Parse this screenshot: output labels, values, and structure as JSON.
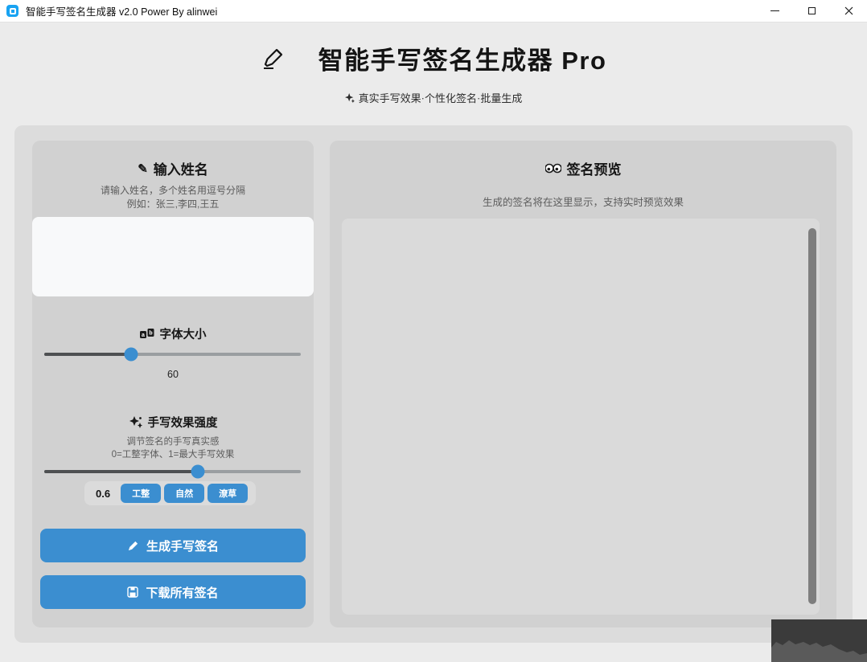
{
  "titlebar": {
    "app_title": "智能手写签名生成器 v2.0 Power By alinwei"
  },
  "header": {
    "title": "智能手写签名生成器 Pro",
    "subtitle": "真实手写效果·个性化签名·批量生成"
  },
  "name_section": {
    "heading": "输入姓名",
    "memo_glyph": "✎",
    "hint_line1": "请输入姓名，多个姓名用逗号分隔",
    "hint_line2": "例如：张三,李四,王五",
    "input_value": ""
  },
  "font_size_section": {
    "heading": "字体大小",
    "value": "60",
    "slider_percent": 34
  },
  "effect_section": {
    "heading": "手写效果强度",
    "hint_line1": "调节签名的手写真实感",
    "hint_line2": "0=工整字体、1=最大手写效果",
    "value": "0.6",
    "slider_percent": 60,
    "presets": [
      "工整",
      "自然",
      "潦草"
    ]
  },
  "actions": {
    "generate_label": "生成手写签名",
    "download_label": "下载所有签名"
  },
  "preview_section": {
    "heading": "签名预览",
    "hint": "生成的签名将在这里显示，支持实时预览效果"
  },
  "icons": {
    "app": "app-logo-square",
    "header": "writing-hand",
    "subtitle": "sparkle",
    "name": "memo-pencil",
    "font_size": "letter-tiles",
    "effect": "sparkles",
    "generate": "pen",
    "download": "save-disk",
    "preview": "eyes"
  },
  "colors": {
    "accent_blue": "#3b8ed0",
    "app_icon_blue": "#18a3f2",
    "titlebar_bg": "#ffffff",
    "window_bg": "#ebebeb",
    "container_bg": "#dcdcdc",
    "panel_bg": "#d1d1d1",
    "input_bg": "#f8f9fa",
    "preview_bg": "#dadada",
    "slider_fill": "#4e5052",
    "slider_track": "#9a9ea1",
    "scrollbar": "#7e7e7e",
    "watermark_bg": "#3b3b3b",
    "watermark_hills": "#5a5a5a"
  }
}
